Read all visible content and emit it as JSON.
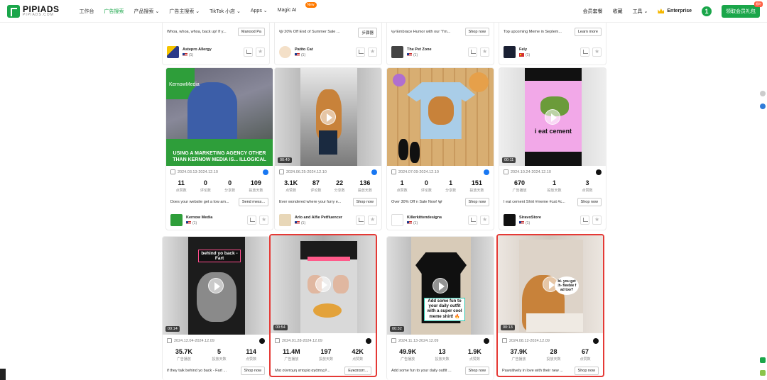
{
  "brand": {
    "name": "PIPIADS",
    "sub": "PIPIADS.COM"
  },
  "nav": [
    {
      "label": "工作台"
    },
    {
      "label": "广告搜索",
      "active": true
    },
    {
      "label": "产品搜索 ⌄"
    },
    {
      "label": "广告主搜索 ⌄"
    },
    {
      "label": "TikTok 小店 ⌄"
    },
    {
      "label": "Apps ⌄"
    },
    {
      "label": "Magic AI",
      "badge": "New"
    }
  ],
  "topright": {
    "items": [
      "会员套餐",
      "收藏",
      "工具 ⌄"
    ],
    "plan": "Enterprise",
    "avatar": "1",
    "cta": "领取会员礼包",
    "cta_badge": "限时"
  },
  "top_row": [
    {
      "desc": "Whoa, whoa, whoa, back up! If y...",
      "cta": "Manood Pa",
      "adv": "Astepro Allergy",
      "country": "(1)",
      "flag": "us"
    },
    {
      "desc": "😾 20% Off End of Summer Sale ...",
      "cta": "步骤器",
      "adv": "Patito Cat",
      "country": "(1)",
      "flag": "us"
    },
    {
      "desc": "🐱 Embrace Humor with our \"I'm...",
      "cta": "Shop now",
      "adv": "The Pet Zone",
      "country": "(1)",
      "flag": "us"
    },
    {
      "desc": "Top upcoming Meme in Septem...",
      "cta": "Learn more",
      "adv": "Fely",
      "country": "(1)",
      "flag": "cn"
    }
  ],
  "row2": [
    {
      "date": "2024.03.13-2024.12.10",
      "platform": "facebook",
      "stats": [
        {
          "v": "11",
          "l": "点赞数"
        },
        {
          "v": "0",
          "l": "评论数"
        },
        {
          "v": "0",
          "l": "分享数"
        },
        {
          "v": "109",
          "l": "投放天数"
        }
      ],
      "desc": "Does your website get a low am...",
      "cta": "Send mess...",
      "adv": "Kernow Media",
      "country": "(1)",
      "overlay": "USING A MARKETING AGENCY OTHER THAN KERNOW MEDIA IS... ILLOGICAL",
      "brand": "KernowMedia"
    },
    {
      "date": "2024.06.25-2024.12.10",
      "platform": "facebook",
      "duration": "00:49",
      "stats": [
        {
          "v": "3.1K",
          "l": "点赞数"
        },
        {
          "v": "87",
          "l": "评论数"
        },
        {
          "v": "22",
          "l": "分享数"
        },
        {
          "v": "136",
          "l": "投放天数"
        }
      ],
      "desc": "Ever wondered where your furry e...",
      "cta": "Shop now",
      "adv": "Arlo and Alfie Petfluencer",
      "country": "(1)"
    },
    {
      "date": "2024.07.09-2024.12.10",
      "platform": "facebook",
      "stats": [
        {
          "v": "1",
          "l": "点赞数"
        },
        {
          "v": "0",
          "l": "评论数"
        },
        {
          "v": "1",
          "l": "分享数"
        },
        {
          "v": "151",
          "l": "投放天数"
        }
      ],
      "desc": "Over 30% Off n Sale Now! 😺",
      "cta": "Shop now",
      "adv": "Killerkittendesigns",
      "country": "(1)"
    },
    {
      "date": "2024.10.24-2024.12.10",
      "platform": "tiktok",
      "duration": "00:11",
      "stats": [
        {
          "v": "670",
          "l": "广告播放"
        },
        {
          "v": "1",
          "l": "投放天数"
        },
        {
          "v": "3",
          "l": "点赞数"
        }
      ],
      "desc": "I eat cement Shirt #meme #cat #c...",
      "cta": "Shop now",
      "adv": "SiravoStore",
      "country": "(1)",
      "overlay": "i eat cement"
    }
  ],
  "row3": [
    {
      "date": "2024.12.04-2024.12.09",
      "platform": "tiktok",
      "duration": "00:14",
      "stats": [
        {
          "v": "35.7K",
          "l": "广告播放"
        },
        {
          "v": "5",
          "l": "投放天数"
        },
        {
          "v": "114",
          "l": "点赞数"
        }
      ],
      "desc": "if they talk behind yo back - Fart ...",
      "cta": "Shop now",
      "overlay": "behind yo back - Fart",
      "selected": false
    },
    {
      "date": "2024.01.28-2024.12.09",
      "platform": "tiktok",
      "duration": "00:54",
      "stats": [
        {
          "v": "11.4M",
          "l": "广告播放"
        },
        {
          "v": "197",
          "l": "投放天数"
        },
        {
          "v": "42K",
          "l": "点赞数"
        }
      ],
      "desc": "Μια σύντομη ιστορία αγάπης#...",
      "cta": "Εγκαταστ...",
      "selected": true
    },
    {
      "date": "2024.11.13-2024.12.09",
      "platform": "tiktok",
      "duration": "00:32",
      "stats": [
        {
          "v": "49.9K",
          "l": "广告播放"
        },
        {
          "v": "13",
          "l": "投放天数"
        },
        {
          "v": "1.9K",
          "l": "点赞数"
        }
      ],
      "desc": "Add some fun to your daily outfit ...",
      "cta": "Shop now",
      "overlay": "Add some fun to your daily outfit with a super cool meme shirt! 🔥",
      "selected": false
    },
    {
      "date": "2024.08.12-2024.12.09",
      "platform": "tiktok",
      "duration": "00:13",
      "stats": [
        {
          "v": "37.9K",
          "l": "广告播放"
        },
        {
          "v": "28",
          "l": "投放天数"
        },
        {
          "v": "67",
          "l": "点赞数"
        }
      ],
      "desc": "Pawsitively in love with their new ...",
      "cta": "Shop now",
      "overlay": "bi- you get th- fleeble f ad too?",
      "selected": true
    }
  ]
}
